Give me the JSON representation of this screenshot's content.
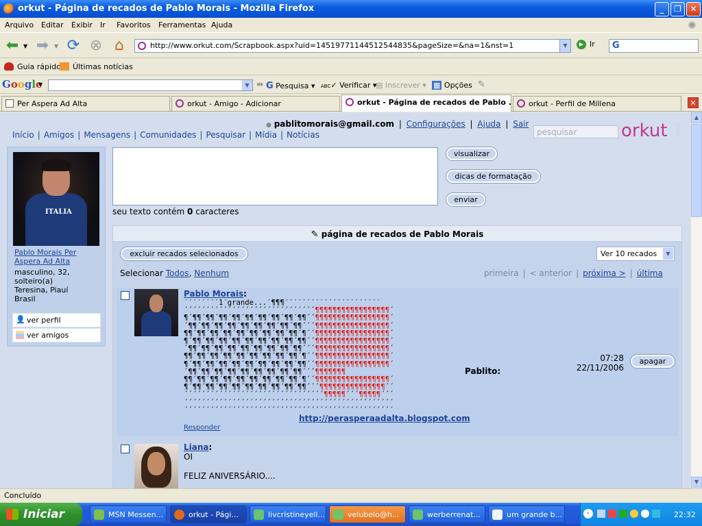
{
  "window": {
    "title": "orkut - Página de recados de Pablo Morais - Mozilla Firefox"
  },
  "menu": [
    "Arquivo",
    "Editar",
    "Exibir",
    "Ir",
    "Favoritos",
    "Ferramentas",
    "Ajuda"
  ],
  "nav": {
    "url": "http://www.orkut.com/Scrapbook.aspx?uid=14519771144512544835&pageSize=&na=1&nst=1",
    "go_label": "Ir",
    "search_glyph": "G"
  },
  "bookmarks": [
    "Guia rápido",
    "Últimas notícias"
  ],
  "google_toolbar": {
    "logo": "Google",
    "pesquisa": "Pesquisa",
    "verificar": "Verificar",
    "inscrever": "Inscrever",
    "opcoes": "Opções",
    "abc": "ABC"
  },
  "tabs": [
    {
      "label": "Per Aspera Ad Alta"
    },
    {
      "label": "orkut - Amigo - Adicionar"
    },
    {
      "label": "orkut - Página de recados de Pablo ..."
    },
    {
      "label": "orkut - Perfil de Millena"
    }
  ],
  "header": {
    "email": "pablitomorais@gmail.com",
    "sep": "|",
    "configuracoes": "Configurações",
    "ajuda": "Ajuda",
    "sair": "Sair",
    "search_placeholder": "pesquisar",
    "logo": "orkut",
    "beta": "beta",
    "nav_links": [
      "Início",
      "Amigos",
      "Mensagens",
      "Comunidades",
      "Pesquisar",
      "Mídia",
      "Notícias"
    ]
  },
  "profile": {
    "name": "Pablo Morais Per Aspera Ad Alta",
    "shirt_text": "ITALIA",
    "info": [
      "masculino, 32,",
      "solteiro(a)",
      "Teresina, Piauí",
      "Brasil"
    ],
    "actions": [
      "ver perfil",
      "ver amigos"
    ]
  },
  "composer": {
    "visualizar": "visualizar",
    "dicas": "dicas de formatação",
    "enviar": "enviar",
    "count_prefix": "seu texto contém",
    "count": "0",
    "count_suffix": "caracteres"
  },
  "scrapbook": {
    "title": "página de recados de Pablo Morais",
    "delete_selected": "excluir recados selecionados",
    "per_page": "Ver 10 recados",
    "select_label": "Selecionar",
    "select_all": "Todos",
    "select_none": "Nenhum",
    "pager": {
      "first": "primeira",
      "prev": "< anterior",
      "next": "próxima >",
      "last": "última"
    },
    "scraps": [
      {
        "author": "Pablo Morais",
        "art_start": "´´´´´´´´1´grande...´¶¶¶´´´´´´´´´´´´´´´´´´´´´´",
        "signature": "Pablito:",
        "link": "http://perasperaadalta.blogspot.com",
        "reply": "Responder",
        "time": "07:28",
        "date": "22/11/2006",
        "delete": "apagar"
      },
      {
        "author": "Liana",
        "line1": "OI",
        "line2": "FELIZ ANIVERSÁRIO...."
      }
    ]
  },
  "status": "Concluído",
  "taskbar": {
    "start": "Iniciar",
    "tasks": [
      "MSN Messen...",
      "orkut - Pági...",
      "livcristineyell...",
      "velubelo@h...",
      "werberrenat...",
      "um grande b..."
    ],
    "clock": "22:32"
  }
}
